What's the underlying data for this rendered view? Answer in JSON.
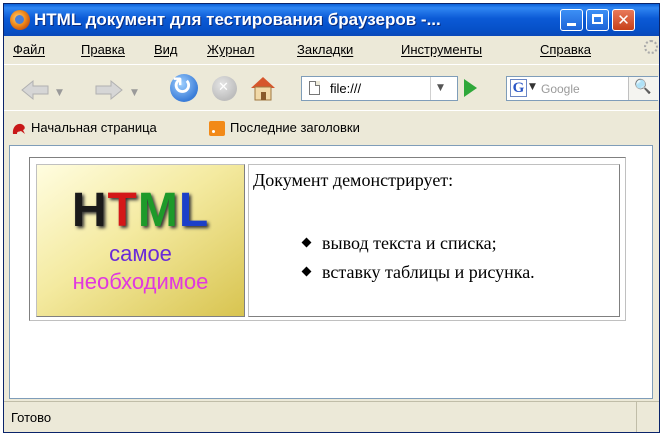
{
  "window": {
    "title": "HTML документ для тестирования браузеров -..."
  },
  "menubar": {
    "items": [
      "Файл",
      "Правка",
      "Вид",
      "Журнал",
      "Закладки",
      "Инструменты",
      "Справка"
    ]
  },
  "navbar": {
    "url": "file:///",
    "search_placeholder": "Google",
    "search_engine_letter": "G"
  },
  "bookmarks": {
    "items": [
      "Начальная страница",
      "Последние заголовки"
    ]
  },
  "page": {
    "image": {
      "logo_letters": [
        {
          "ch": "H",
          "color": "#1a1a1a"
        },
        {
          "ch": "T",
          "color": "#d41818"
        },
        {
          "ch": "M",
          "color": "#1e9a2a"
        },
        {
          "ch": "L",
          "color": "#1b3fc8"
        }
      ],
      "line1": "самое",
      "line2": "необходимое",
      "line1_color": "#6a2ad8",
      "line2_color": "#e038e0"
    },
    "intro": "Документ демонстрирует:",
    "list": [
      "вывод текста и списка;",
      "вставку таблицы и рисунка."
    ]
  },
  "status": {
    "text": "Готово"
  }
}
